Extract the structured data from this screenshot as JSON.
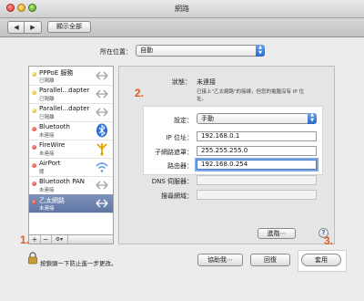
{
  "window": {
    "title": "網路"
  },
  "toolbar": {
    "back_label": "◀",
    "forward_label": "▶",
    "show_all_label": "顯示全部"
  },
  "location": {
    "label": "所在位置：",
    "value": "自動"
  },
  "services": [
    {
      "name": "PPPoE 服務",
      "status": "已隔離",
      "dot": "yellow",
      "icon": "arrows-icon"
    },
    {
      "name": "Parallel...dapter",
      "status": "已隔離",
      "dot": "yellow",
      "icon": "arrows-icon"
    },
    {
      "name": "Parallel...dapter",
      "status": "已隔離",
      "dot": "yellow",
      "icon": "arrows-icon"
    },
    {
      "name": "Bluetooth",
      "status": "未連接",
      "dot": "red",
      "icon": "bluetooth-icon"
    },
    {
      "name": "FireWire",
      "status": "未連接",
      "dot": "red",
      "icon": "firewire-icon"
    },
    {
      "name": "AirPort",
      "status": "關",
      "dot": "red",
      "icon": "wifi-icon"
    },
    {
      "name": "Bluetooth PAN",
      "status": "未連接",
      "dot": "red",
      "icon": "arrows-icon"
    },
    {
      "name": "乙太網路",
      "status": "未連接",
      "dot": "red",
      "icon": "ethernet-icon",
      "selected": true
    }
  ],
  "sidebar_controls": {
    "add": "+",
    "remove": "−",
    "action": "⚙▾"
  },
  "detail": {
    "status_label": "狀態：",
    "status_value": "未連接",
    "status_desc_line1": "已接上\"乙太網路\"的接線，但您的電腦沒有 IP 位",
    "status_desc_line2": "址。",
    "configure_label": "設定：",
    "configure_value": "手動",
    "ip_label": "IP 位址：",
    "ip_value": "192.168.0.1",
    "subnet_label": "子網路遮罩：",
    "subnet_value": "255.255.255.0",
    "router_label": "路由器：",
    "router_value": "192.168.0.254",
    "dns_label": "DNS 伺服器：",
    "dns_value": "",
    "search_label": "搜尋網域：",
    "search_value": "",
    "advanced_label": "進階⋯",
    "help_label": "?"
  },
  "footer": {
    "lock_text": "按鎖頭一下防止進一步更改。",
    "assist_label": "協助我⋯",
    "revert_label": "回復",
    "apply_label": "套用"
  },
  "callouts": {
    "one": "1.",
    "two": "2.",
    "three": "3."
  },
  "colors": {
    "callout": "#e05a1f",
    "selection": "#6b80ae",
    "focus_ring": "#7fa7e2",
    "accent_popup": "#2966c7"
  }
}
